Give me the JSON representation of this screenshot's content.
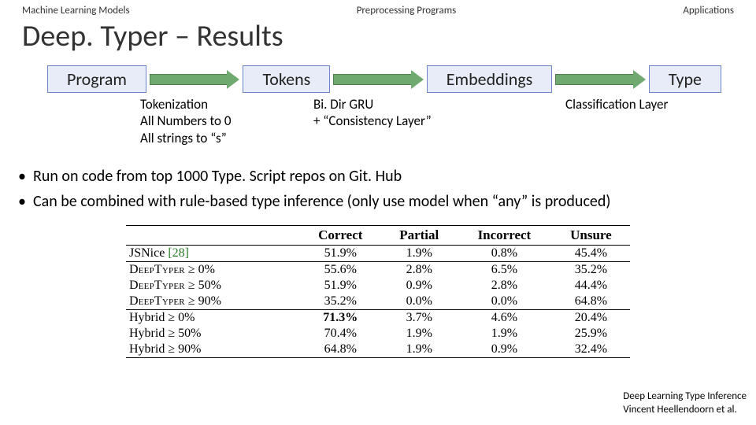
{
  "nav": {
    "left": "Machine Learning Models",
    "center": "Preprocessing Programs",
    "right": "Applications"
  },
  "title": "Deep. Typer – Results",
  "pipeline": {
    "b1": "Program",
    "b2": "Tokens",
    "b3": "Embeddings",
    "b4": "Type"
  },
  "annot": {
    "a1_l1": "Tokenization",
    "a1_l2": "All Numbers to 0",
    "a1_l3": "All strings to “s”",
    "a2_l1": "Bi. Dir GRU",
    "a2_l2": "+ “Consistency Layer”",
    "a3": "Classification Layer"
  },
  "bullets": {
    "b1": "Run on code from top 1000 Type. Script repos on Git. Hub",
    "b2": "Can be combined with rule-based type inference (only use model when “any” is produced)"
  },
  "chart_data": {
    "type": "table",
    "title": "",
    "columns": [
      "",
      "Correct",
      "Partial",
      "Incorrect",
      "Unsure"
    ],
    "rows": [
      {
        "label_html": "JSNice <span class='cite'>[28]</span>",
        "vals": [
          "51.9%",
          "1.9%",
          "0.8%",
          "45.4%"
        ]
      },
      {
        "sep": true,
        "label_html": "<span class='sc'>DeepTyper</span> ≥ 0%",
        "vals": [
          "55.6%",
          "2.8%",
          "6.5%",
          "35.2%"
        ]
      },
      {
        "label_html": "<span class='sc'>DeepTyper</span> ≥ 50%",
        "vals": [
          "51.9%",
          "0.9%",
          "2.8%",
          "44.4%"
        ]
      },
      {
        "label_html": "<span class='sc'>DeepTyper</span> ≥ 90%",
        "vals": [
          "35.2%",
          "0.0%",
          "0.0%",
          "64.8%"
        ]
      },
      {
        "sep": true,
        "bold": true,
        "label_html": "Hybrid ≥ 0%",
        "vals": [
          "71.3%",
          "3.7%",
          "4.6%",
          "20.4%"
        ]
      },
      {
        "label_html": "Hybrid ≥ 50%",
        "vals": [
          "70.4%",
          "1.9%",
          "1.9%",
          "25.9%"
        ]
      },
      {
        "last": true,
        "label_html": "Hybrid ≥ 90%",
        "vals": [
          "64.8%",
          "1.9%",
          "0.9%",
          "32.4%"
        ]
      }
    ]
  },
  "foot": {
    "l1": "Deep Learning Type Inference",
    "l2": "Vincent Heellendoorn et al."
  }
}
